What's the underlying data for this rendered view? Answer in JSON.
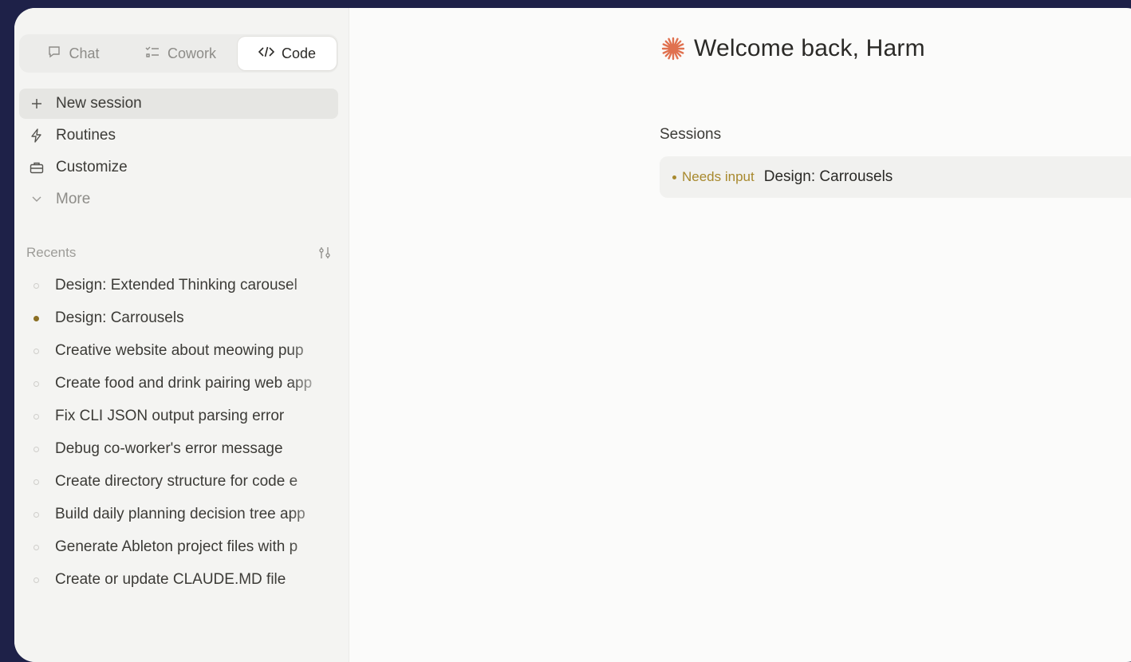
{
  "colors": {
    "backdrop": "#1e2148",
    "window_bg": "#fbfbfa",
    "sidebar_bg": "#f4f4f2",
    "accent_spark": "#e0714f",
    "needs_input": "#a8892e"
  },
  "mode_tabs": [
    {
      "label": "Chat",
      "icon": "chat-bubble-icon"
    },
    {
      "label": "Cowork",
      "icon": "checklist-icon"
    },
    {
      "label": "Code",
      "icon": "code-brackets-icon",
      "selected": true
    }
  ],
  "nav": [
    {
      "label": "New session",
      "icon": "plus-icon",
      "active": true
    },
    {
      "label": "Routines",
      "icon": "lightning-icon"
    },
    {
      "label": "Customize",
      "icon": "briefcase-icon"
    },
    {
      "label": "More",
      "icon": "chevron-down-icon"
    }
  ],
  "recents": {
    "label": "Recents",
    "filter_icon": "filter-sliders-icon",
    "items": [
      {
        "label": "Design: Extended Thinking carousel",
        "active": false
      },
      {
        "label": "Design: Carrousels",
        "active": true
      },
      {
        "label": "Creative website about meowing pup",
        "active": false
      },
      {
        "label": "Create food and drink pairing web app",
        "active": false
      },
      {
        "label": "Fix CLI JSON output parsing error",
        "active": false
      },
      {
        "label": "Debug co-worker's error message",
        "active": false
      },
      {
        "label": "Create directory structure for code e",
        "active": false
      },
      {
        "label": "Build daily planning decision tree app",
        "active": false
      },
      {
        "label": "Generate Ableton project files with p",
        "active": false
      },
      {
        "label": "Create or update CLAUDE.MD file",
        "active": false
      }
    ]
  },
  "main": {
    "welcome": "Welcome back, Harm",
    "spark_icon": "sparkle-icon",
    "sessions_label": "Sessions",
    "session": {
      "status": "Needs input",
      "title": "Design: Carrousels"
    }
  }
}
